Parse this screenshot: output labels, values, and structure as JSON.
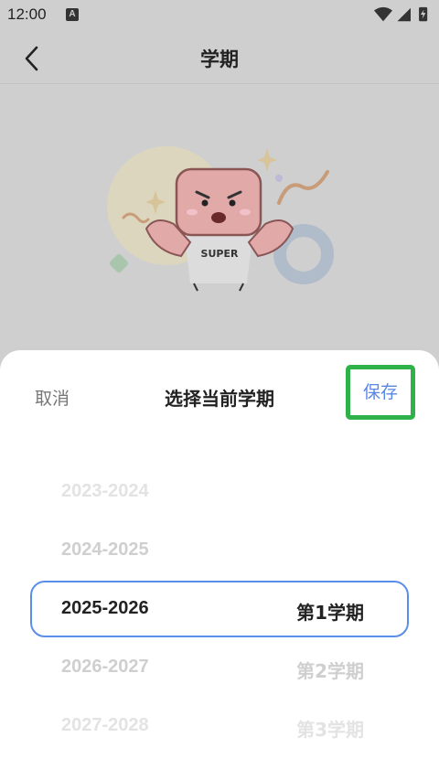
{
  "status": {
    "time": "12:00",
    "notif": "A"
  },
  "header": {
    "title": "学期"
  },
  "illustration": {
    "shirt_text": "SUPER"
  },
  "sheet": {
    "cancel": "取消",
    "title": "选择当前学期",
    "save": "保存"
  },
  "picker": {
    "years": [
      "2023-2024",
      "2024-2025",
      "2025-2026",
      "2026-2027",
      "2027-2028"
    ],
    "terms": [
      "第1学期",
      "第2学期",
      "第3学期"
    ],
    "selected_year": "2025-2026",
    "selected_term": "第1学期"
  },
  "colors": {
    "accent": "#5a86e6",
    "highlight": "#2fb24a",
    "selection_border": "#5b8ee8"
  }
}
